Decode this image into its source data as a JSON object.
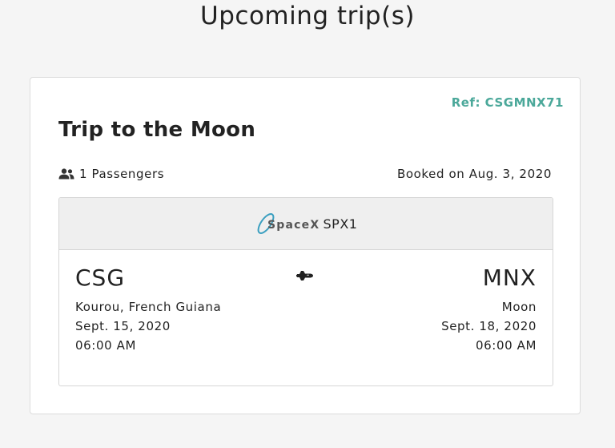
{
  "page": {
    "title": "Upcoming trip(s)"
  },
  "trip": {
    "ref": "Ref: CSGMNX71",
    "title": "Trip to the Moon",
    "passengers": "1 Passengers",
    "booked": "Booked on Aug. 3, 2020",
    "carrier_logo_text": "SpaceX",
    "flight_code": "SPX1",
    "from": {
      "code": "CSG",
      "place": "Kourou, French Guiana",
      "date": "Sept. 15, 2020",
      "time": "06:00 AM"
    },
    "to": {
      "code": "MNX",
      "place": "Moon",
      "date": "Sept. 18, 2020",
      "time": "06:00 AM"
    }
  },
  "colors": {
    "accent": "#4ba89a",
    "logo_blue": "#3a9fc0"
  },
  "icons": {
    "passengers": "users-icon",
    "shuttle": "space-shuttle-icon",
    "carrier": "spacex-logo"
  }
}
